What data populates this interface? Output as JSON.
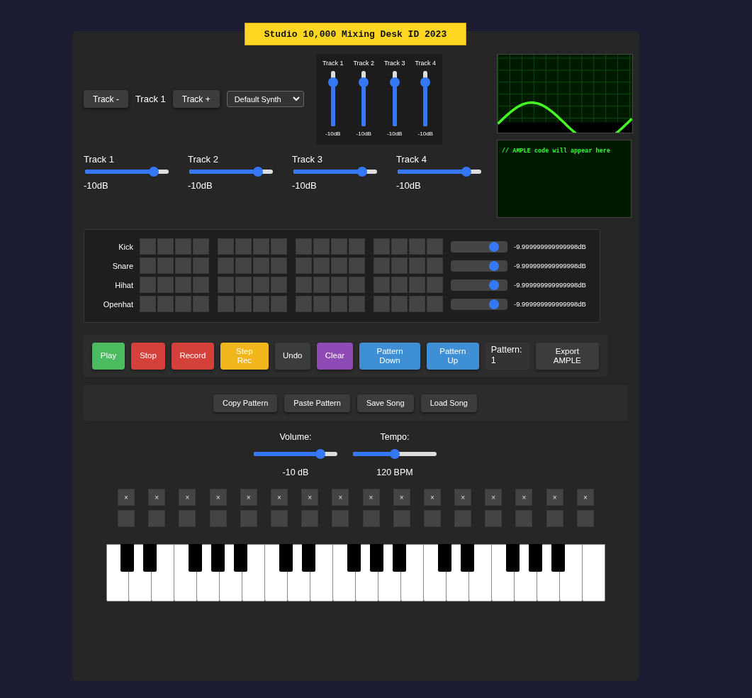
{
  "title": "Studio 10,000 Mixing Desk ID 2023",
  "track_nav": {
    "prev": "Track -",
    "current": "Track 1",
    "next": "Track +",
    "instrument": "Default Synth"
  },
  "mixer": [
    {
      "label": "Track 1",
      "level": 0.8,
      "reading": "-10dB"
    },
    {
      "label": "Track 2",
      "level": 0.8,
      "reading": "-10dB"
    },
    {
      "label": "Track 3",
      "level": 0.8,
      "reading": "-10dB"
    },
    {
      "label": "Track 4",
      "level": 0.8,
      "reading": "-10dB"
    }
  ],
  "code_view": {
    "text": "// AMPLE code will appear here"
  },
  "track_sliders": [
    {
      "label": "Track 1",
      "level": 0.82,
      "reading": "-10dB"
    },
    {
      "label": "Track 2",
      "level": 0.82,
      "reading": "-10dB"
    },
    {
      "label": "Track 3",
      "level": 0.82,
      "reading": "-10dB"
    },
    {
      "label": "Track 4",
      "level": 0.82,
      "reading": "-10dB"
    }
  ],
  "drum_rows": [
    {
      "name": "Kick",
      "steps": [
        false,
        false,
        false,
        false,
        false,
        false,
        false,
        false,
        false,
        false,
        false,
        false,
        false,
        false,
        false,
        false
      ],
      "level": 0.78,
      "reading": "-9.999999999999998dB"
    },
    {
      "name": "Snare",
      "steps": [
        false,
        false,
        false,
        false,
        false,
        false,
        false,
        false,
        false,
        false,
        false,
        false,
        false,
        false,
        false,
        false
      ],
      "level": 0.78,
      "reading": "-9.999999999999998dB"
    },
    {
      "name": "Hihat",
      "steps": [
        false,
        false,
        false,
        false,
        false,
        false,
        false,
        false,
        false,
        false,
        false,
        false,
        false,
        false,
        false,
        false
      ],
      "level": 0.78,
      "reading": "-9.999999999999998dB"
    },
    {
      "name": "Openhat",
      "steps": [
        false,
        false,
        false,
        false,
        false,
        false,
        false,
        false,
        false,
        false,
        false,
        false,
        false,
        false,
        false,
        false
      ],
      "level": 0.78,
      "reading": "-9.999999999999998dB"
    }
  ],
  "transport": [
    {
      "label": "Play",
      "kind": "play"
    },
    {
      "label": "Stop",
      "kind": "stop"
    },
    {
      "label": "Record",
      "kind": "record"
    },
    {
      "label": "Step Rec",
      "kind": "steprec"
    },
    {
      "label": "Undo",
      "kind": "undo"
    },
    {
      "label": "Clear",
      "kind": "clear"
    },
    {
      "label": "Pattern Down",
      "kind": "patdown"
    },
    {
      "label": "Pattern Up",
      "kind": "patup"
    },
    {
      "label": "Pattern: 1",
      "kind": "display"
    },
    {
      "label": "Export AMPLE",
      "kind": "export"
    }
  ],
  "song_buttons": [
    "Copy Pattern",
    "Paste Pattern",
    "Save Song",
    "Load Song"
  ],
  "master": [
    {
      "label": "Volume:",
      "level": 0.8,
      "reading": "-10 dB"
    },
    {
      "label": "Tempo:",
      "level": 0.5,
      "reading": "120 BPM"
    }
  ],
  "step_toggles": [
    {
      "label": "×",
      "active": false
    },
    {
      "label": "×",
      "active": false
    },
    {
      "label": "×",
      "active": false
    },
    {
      "label": "×",
      "active": false
    },
    {
      "label": "×",
      "active": false
    },
    {
      "label": "×",
      "active": false
    },
    {
      "label": "×",
      "active": false
    },
    {
      "label": "×",
      "active": false
    },
    {
      "label": "×",
      "active": false
    },
    {
      "label": "×",
      "active": false
    },
    {
      "label": "×",
      "active": false
    },
    {
      "label": "×",
      "active": false
    },
    {
      "label": "×",
      "active": false
    },
    {
      "label": "×",
      "active": false
    },
    {
      "label": "×",
      "active": false
    },
    {
      "label": "×",
      "active": false
    }
  ],
  "pads": [
    {
      "active": false
    },
    {
      "active": false
    },
    {
      "active": false
    },
    {
      "active": false
    },
    {
      "active": false
    },
    {
      "active": false
    },
    {
      "active": false
    },
    {
      "active": false
    },
    {
      "active": false
    },
    {
      "active": false
    },
    {
      "active": false
    },
    {
      "active": false
    },
    {
      "active": false
    },
    {
      "active": false
    },
    {
      "active": false
    },
    {
      "active": false
    }
  ]
}
